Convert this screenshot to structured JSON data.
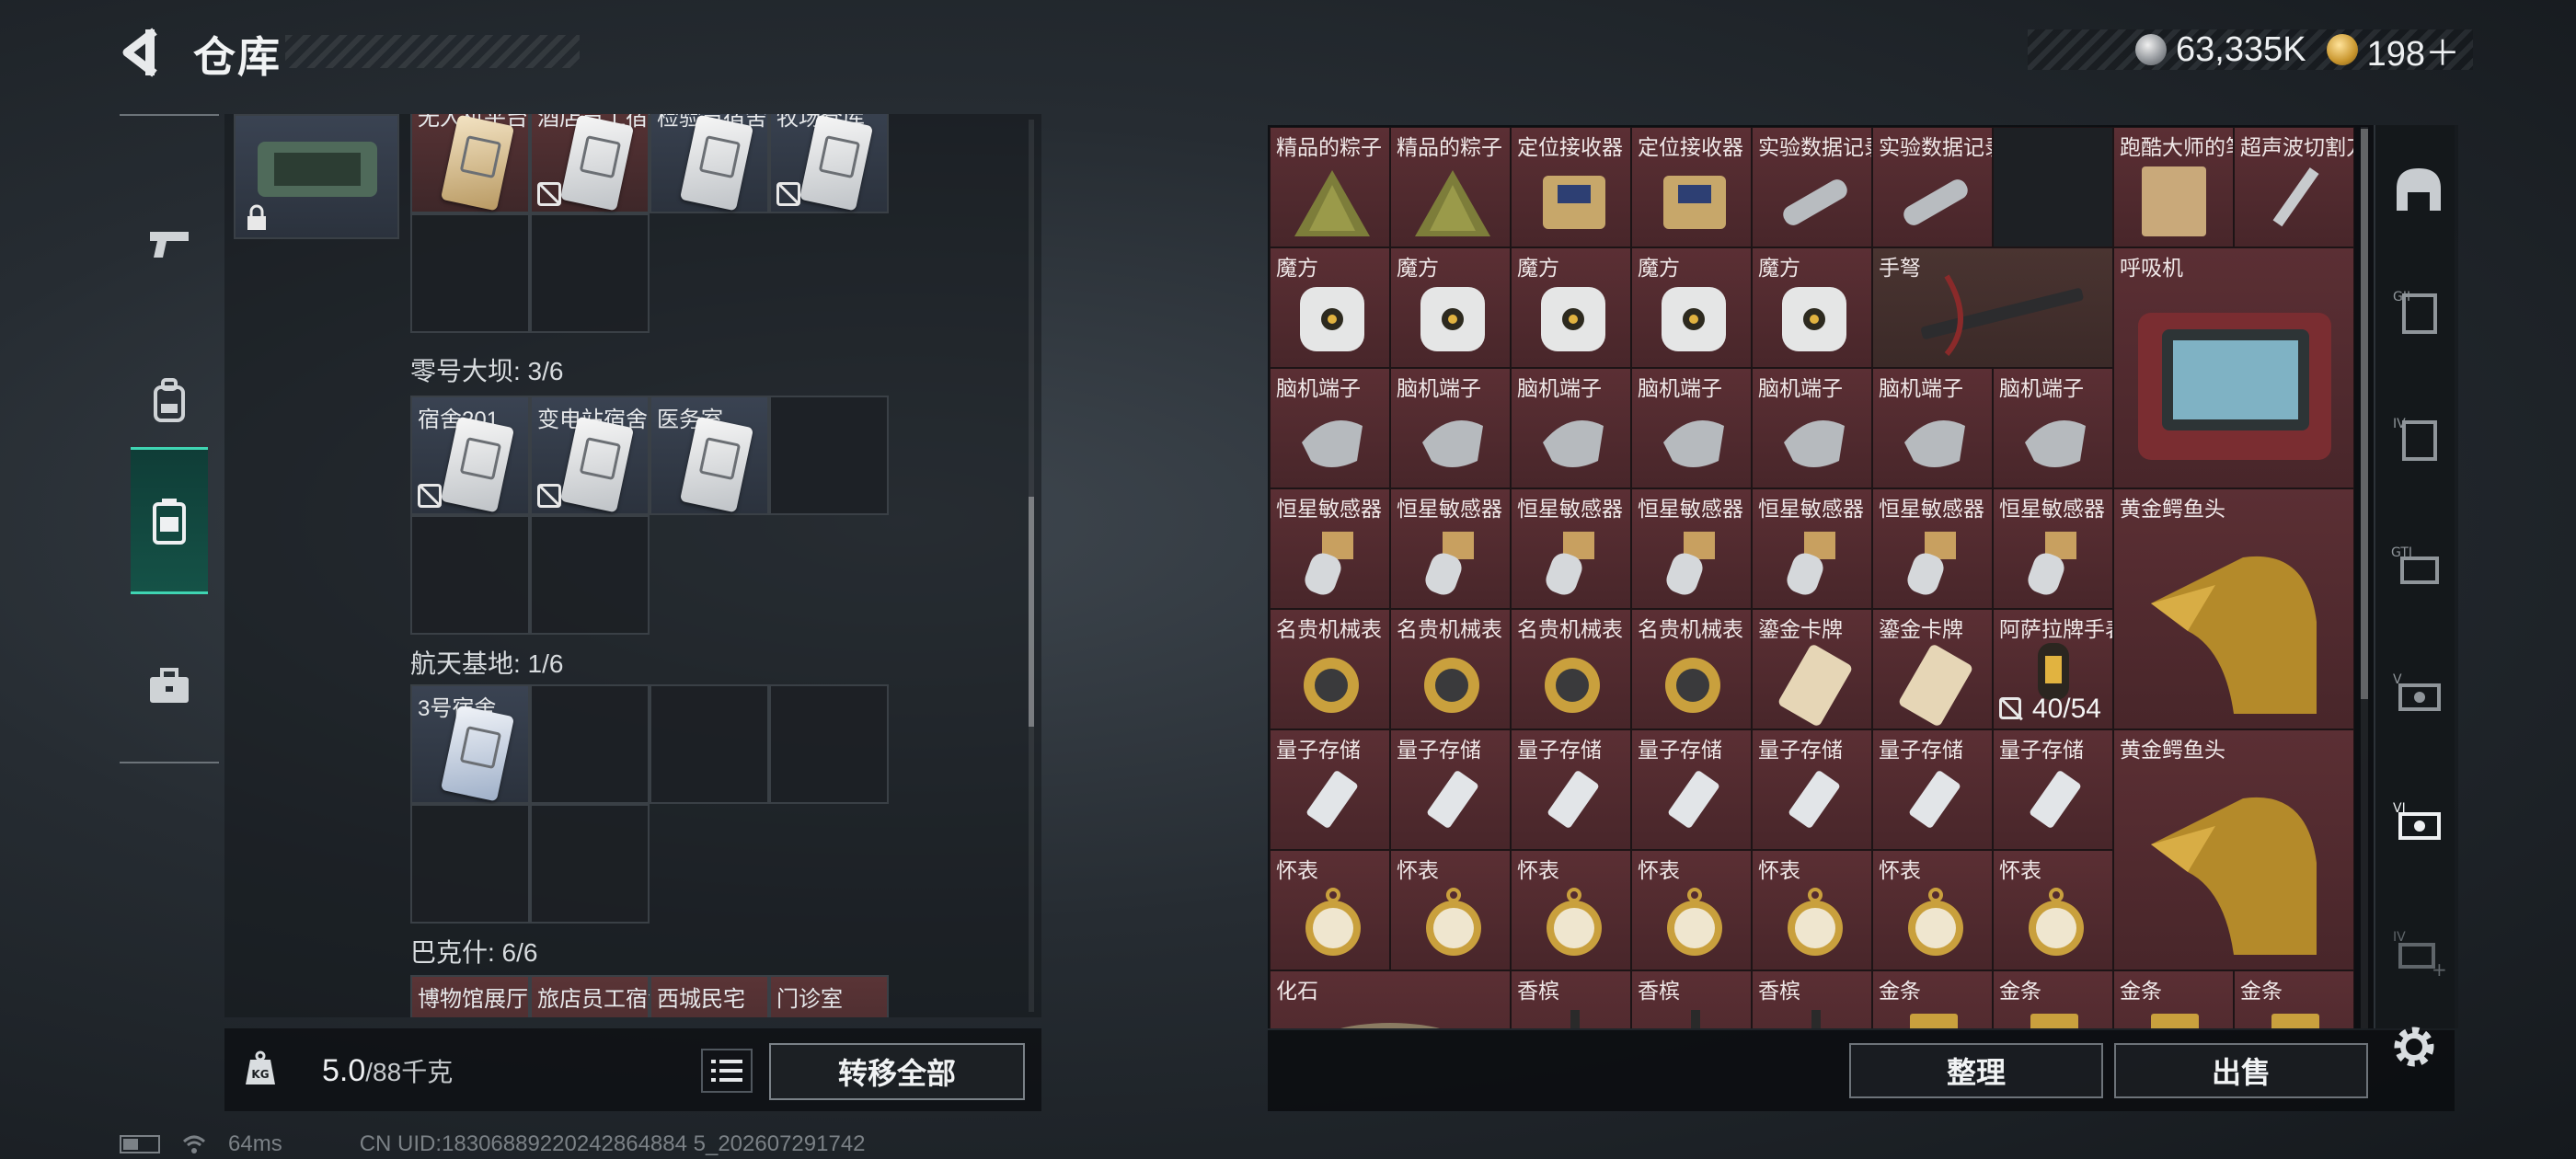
{
  "header": {
    "title": "仓库",
    "currency": [
      {
        "icon": "silver-coin-icon",
        "value": "63,335K"
      },
      {
        "icon": "gold-coin-icon",
        "value": "198＋"
      }
    ]
  },
  "left_rail": {
    "items": [
      {
        "icon": "pistol-icon",
        "active": false
      },
      {
        "icon": "backpack-icon",
        "active": false
      },
      {
        "icon": "keycard-case-icon",
        "active": true
      },
      {
        "icon": "briefcase-icon",
        "active": false
      }
    ]
  },
  "warehouse": {
    "top_row_labels": [
      "无人机平台",
      "酒店员工宿舍",
      "检验员宿舍",
      "牧场仓库"
    ],
    "sections": [
      {
        "title": "零号大坝: 3/6",
        "cards": [
          "宿舍201",
          "变电站宿舍",
          "医务室"
        ]
      },
      {
        "title": "航天基地: 1/6",
        "cards": [
          "3号宿舍"
        ]
      },
      {
        "title": "巴克什: 6/6",
        "cards": [
          "博物馆展厅",
          "旅店员工宿舍",
          "西城民宅",
          "门诊室"
        ]
      }
    ],
    "weight_current": "5.0",
    "weight_max": "/88千克",
    "transfer_all": "转移全部"
  },
  "inventory": {
    "row1": [
      "精品的粽子",
      "精品的粽子",
      "定位接收器",
      "定位接收器",
      "实验数据记录仪",
      "实验数据记录仪",
      "",
      "跑酷大师的笔记",
      "超声波切割刀"
    ],
    "row2": [
      "魔方",
      "魔方",
      "魔方",
      "魔方",
      "魔方",
      "手弩",
      "呼吸机"
    ],
    "row3": [
      "脑机端子",
      "脑机端子",
      "脑机端子",
      "脑机端子",
      "脑机端子",
      "脑机端子",
      "脑机端子"
    ],
    "row4": [
      "恒星敏感器",
      "恒星敏感器",
      "恒星敏感器",
      "恒星敏感器",
      "恒星敏感器",
      "恒星敏感器",
      "恒星敏感器",
      "黄金鳄鱼头"
    ],
    "row5": [
      "名贵机械表",
      "名贵机械表",
      "名贵机械表",
      "名贵机械表",
      "鎏金卡牌",
      "鎏金卡牌",
      "阿萨拉牌手表"
    ],
    "row5_count": "40/54",
    "row6": [
      "量子存储",
      "量子存储",
      "量子存储",
      "量子存储",
      "量子存储",
      "量子存储",
      "量子存储",
      "黄金鳄鱼头"
    ],
    "row7": [
      "怀表",
      "怀表",
      "怀表",
      "怀表",
      "怀表",
      "怀表",
      "怀表"
    ],
    "row8": [
      "化石",
      "香槟",
      "香槟",
      "香槟",
      "金条",
      "金条",
      "金条",
      "金条"
    ],
    "sort_label": "整理",
    "sell_label": "出售"
  },
  "right_rail": {
    "items": [
      "helmet-icon",
      "armor-gii-icon",
      "armor-iv-icon",
      "gti-icon",
      "armor-v-icon",
      "armor-vi-icon",
      "armor-iv-plus-icon"
    ]
  },
  "status": {
    "ping": "64ms",
    "uid": "CN UID:18306889220242864884 5_202607291742"
  },
  "colors": {
    "accent": "#3fd4b2",
    "item_red": "#5b2f34"
  }
}
